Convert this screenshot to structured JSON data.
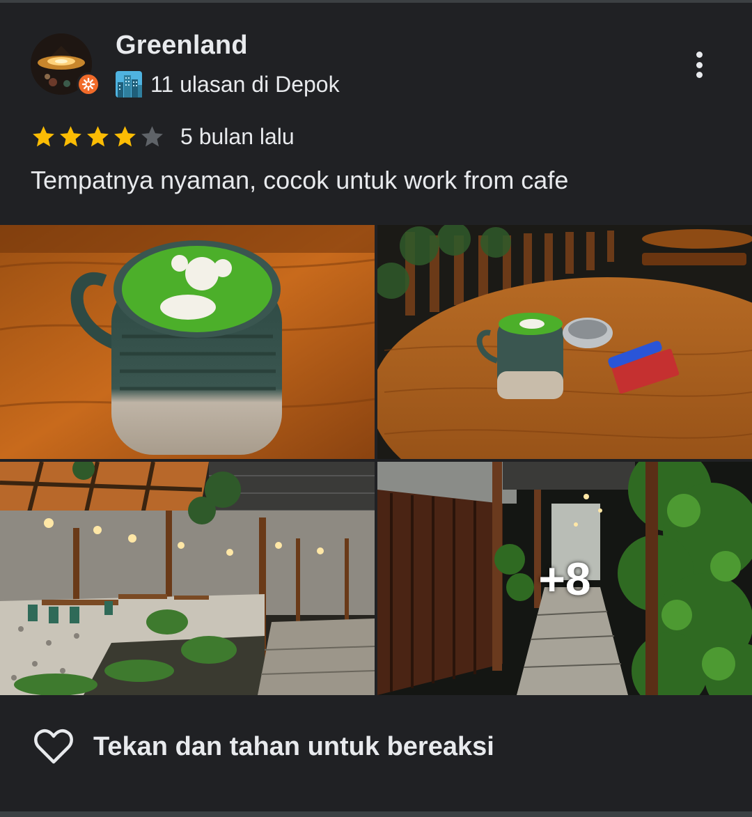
{
  "review": {
    "author": "Greenland",
    "badge_icon": "local-guide-badge-icon",
    "meta_icon": "city-icon",
    "meta_text": "11 ulasan di Depok",
    "rating": 4,
    "rating_max": 5,
    "time_ago": "5 bulan lalu",
    "text": "Tempatnya nyaman, cocok untuk work from cafe",
    "more_icon": "more-vert-icon"
  },
  "photos": {
    "items": [
      "matcha-latte-closeup",
      "table-with-matcha",
      "cafe-seating-area",
      "garden-walkway"
    ],
    "more_count": "+8"
  },
  "reaction": {
    "icon": "heart-outline-icon",
    "label": "Tekan dan tahan untuk bereaksi"
  },
  "colors": {
    "background": "#202124",
    "text": "#e8eaed",
    "star_filled": "#fbbc04",
    "star_empty": "#5f6368",
    "badge": "#f16b2a"
  }
}
